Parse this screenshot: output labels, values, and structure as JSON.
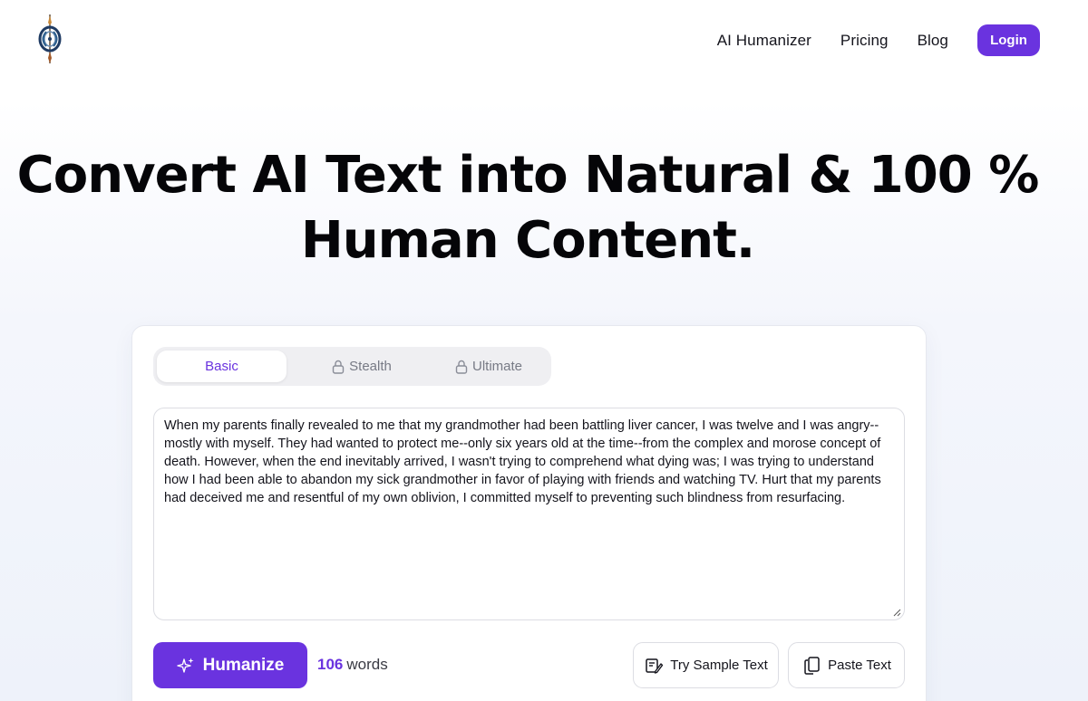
{
  "header": {
    "nav": [
      {
        "label": "AI Humanizer"
      },
      {
        "label": "Pricing"
      },
      {
        "label": "Blog"
      }
    ],
    "login_label": "Login"
  },
  "hero": {
    "title_line1": "Convert AI Text into Natural & 100 %",
    "title_line2": "Human Content."
  },
  "editor": {
    "tabs": [
      {
        "label": "Basic",
        "locked": false,
        "active": true
      },
      {
        "label": "Stealth",
        "locked": true,
        "active": false
      },
      {
        "label": "Ultimate",
        "locked": true,
        "active": false
      }
    ],
    "input_text": "When my parents finally revealed to me that my grandmother had been battling liver cancer, I was twelve and I was angry--mostly with myself. They had wanted to protect me--only six years old at the time--from the complex and morose concept of death. However, when the end inevitably arrived, I wasn't trying to comprehend what dying was; I was trying to understand how I had been able to abandon my sick grandmother in favor of playing with friends and watching TV. Hurt that my parents had deceived me and resentful of my own oblivion, I committed myself to preventing such blindness from resurfacing.",
    "humanize_label": "Humanize",
    "word_count": "106",
    "word_count_suffix": "words",
    "sample_label": "Try Sample Text",
    "paste_label": "Paste Text"
  },
  "colors": {
    "accent": "#6a33df"
  },
  "icons": {
    "logo": "pen-nib-logo",
    "tab_lock": "lock-icon",
    "humanize": "sparkle-icon",
    "sample": "sample-text-icon",
    "paste": "paste-icon"
  }
}
